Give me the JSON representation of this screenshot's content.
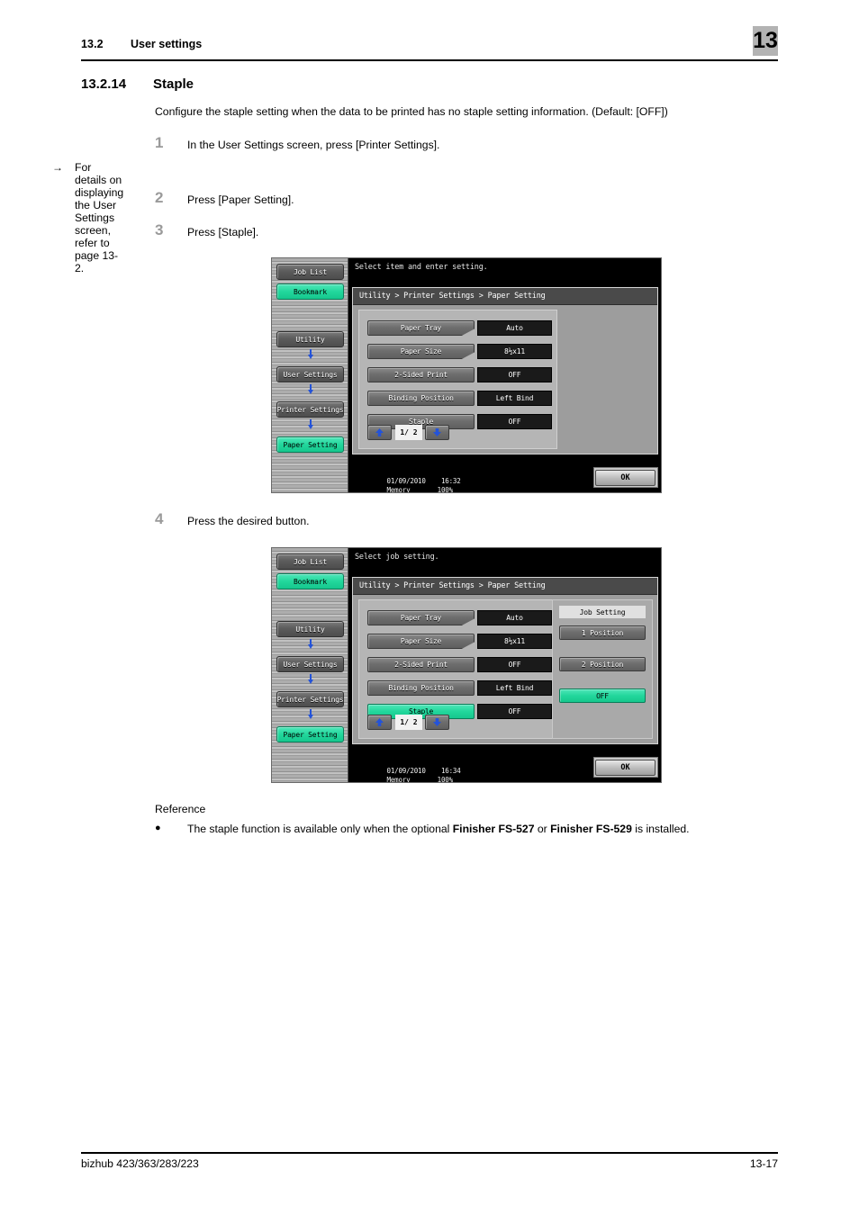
{
  "header": {
    "section_number": "13.2",
    "section_title": "User settings",
    "chapter_badge": "13"
  },
  "section": {
    "number": "13.2.14",
    "title": "Staple"
  },
  "intro": "Configure the staple setting when the data to be printed has no staple setting information. (Default: [OFF])",
  "steps": [
    {
      "num": "1",
      "text": "In the User Settings screen, press [Printer Settings].",
      "substep_arrow": "→",
      "substep": "For details on displaying the User Settings screen, refer to page 13-2."
    },
    {
      "num": "2",
      "text": "Press [Paper Setting]."
    },
    {
      "num": "3",
      "text": "Press [Staple]."
    },
    {
      "num": "4",
      "text": "Press the desired button."
    }
  ],
  "reference": {
    "heading": "Reference",
    "bullet": "●",
    "text_before": "The staple function is available only when the optional ",
    "bold_1": "Finisher FS-527",
    "text_mid": " or ",
    "bold_2": "Finisher FS-529",
    "text_after": " is installed."
  },
  "footer": {
    "model": "bizhub 423/363/283/223",
    "page": "13-17"
  },
  "colors": {
    "accent_green": "#22d79c",
    "arrow_blue": "#2453d8",
    "chapter_badge_bg": "#b3b3b3",
    "step_num_gray": "#9a9a9a"
  },
  "screens": [
    {
      "id": "screen-staple-list",
      "prompt": "Select item and enter setting.",
      "breadcrumb": "Utility > Printer Settings > Paper Setting",
      "sidebar": {
        "top_buttons": [
          {
            "label": "Job List",
            "active": false
          },
          {
            "label": "Bookmark",
            "active": true
          }
        ],
        "nav_buttons": [
          {
            "label": "Utility",
            "active": false
          },
          {
            "label": "User Settings",
            "active": false
          },
          {
            "label": "Printer Settings",
            "active": false
          },
          {
            "label": "Paper Setting",
            "active": true
          }
        ]
      },
      "settings_rows": [
        {
          "label": "Paper Tray",
          "value": "Auto",
          "notch": true,
          "selected": false
        },
        {
          "label": "Paper Size",
          "value": "8½x11",
          "notch": true,
          "selected": false
        },
        {
          "label": "2-Sided Print",
          "value": "OFF",
          "notch": false,
          "selected": false
        },
        {
          "label": "Binding Position",
          "value": "Left Bind",
          "notch": false,
          "selected": false
        },
        {
          "label": "Staple",
          "value": "OFF",
          "notch": false,
          "selected": false
        }
      ],
      "pager": {
        "up_icon": "arrow-up-icon",
        "page": "1/ 2",
        "down_icon": "arrow-down-icon"
      },
      "job_setting_panel": null,
      "status": {
        "date": "01/09/2010",
        "time": "16:32",
        "memory_label": "Memory",
        "memory_value": "100%"
      },
      "ok_label": "OK"
    },
    {
      "id": "screen-staple-options",
      "prompt": "Select job setting.",
      "breadcrumb": "Utility > Printer Settings > Paper Setting",
      "sidebar": {
        "top_buttons": [
          {
            "label": "Job List",
            "active": false
          },
          {
            "label": "Bookmark",
            "active": true
          }
        ],
        "nav_buttons": [
          {
            "label": "Utility",
            "active": false
          },
          {
            "label": "User Settings",
            "active": false
          },
          {
            "label": "Printer Settings",
            "active": false
          },
          {
            "label": "Paper Setting",
            "active": true
          }
        ]
      },
      "settings_rows": [
        {
          "label": "Paper Tray",
          "value": "Auto",
          "notch": true,
          "selected": false
        },
        {
          "label": "Paper Size",
          "value": "8½x11",
          "notch": true,
          "selected": false
        },
        {
          "label": "2-Sided Print",
          "value": "OFF",
          "notch": false,
          "selected": false
        },
        {
          "label": "Binding Position",
          "value": "Left Bind",
          "notch": false,
          "selected": false
        },
        {
          "label": "Staple",
          "value": "OFF",
          "notch": false,
          "selected": true
        }
      ],
      "pager": {
        "up_icon": "arrow-up-icon",
        "page": "1/ 2",
        "down_icon": "arrow-down-icon"
      },
      "job_setting_panel": {
        "title": "Job Setting",
        "options": [
          {
            "label": "1 Position",
            "selected": false
          },
          {
            "label": "2 Position",
            "selected": false
          },
          {
            "label": "OFF",
            "selected": true
          }
        ]
      },
      "status": {
        "date": "01/09/2010",
        "time": "16:34",
        "memory_label": "Memory",
        "memory_value": "100%"
      },
      "ok_label": "OK"
    }
  ]
}
